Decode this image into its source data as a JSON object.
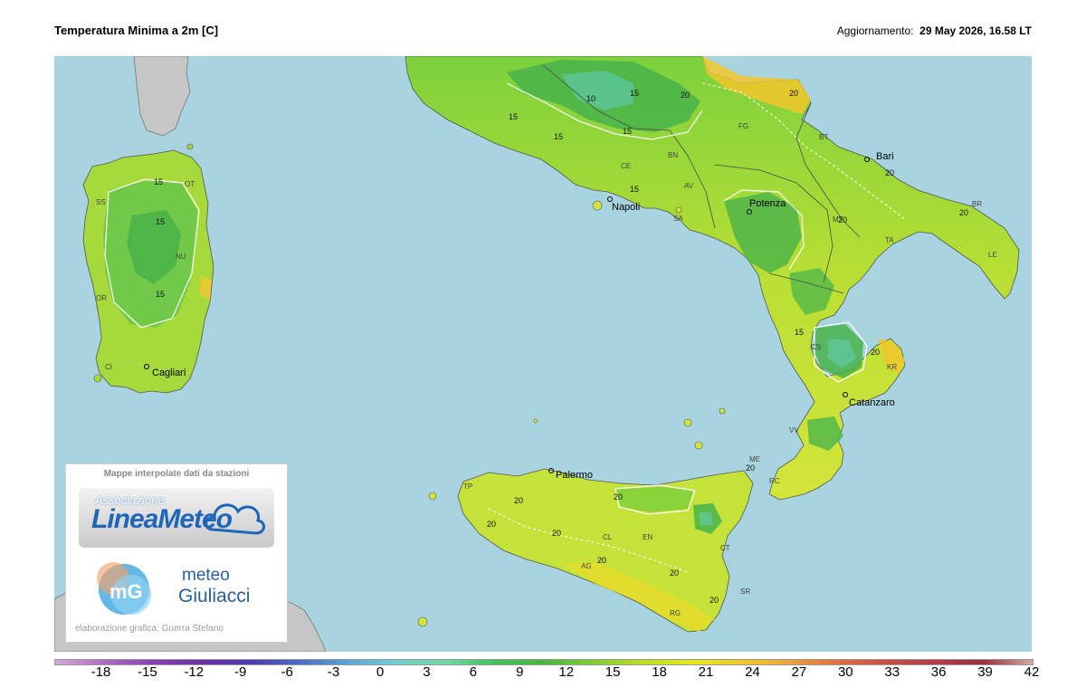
{
  "header": {
    "title": "Temperatura Minima a 2m [C]",
    "updated_label": "Aggiornamento:",
    "updated_value": "29 May 2026, 16.58 LT"
  },
  "cities": [
    "Bari",
    "Napoli",
    "Potenza",
    "Catanzaro",
    "Palermo",
    "Cagliari"
  ],
  "provinces": [
    "FG",
    "BT",
    "BR",
    "LE",
    "TA",
    "MT",
    "CE",
    "BN",
    "AV",
    "SA",
    "CS",
    "KR",
    "VV",
    "RC",
    "ME",
    "TP",
    "AG",
    "CL",
    "EN",
    "CT",
    "SR",
    "RG",
    "SS",
    "OT",
    "NU",
    "OR",
    "CI"
  ],
  "isolines": [
    "20",
    "15",
    "10",
    "20",
    "20",
    "15",
    "15",
    "15",
    "15",
    "20",
    "20",
    "20",
    "20",
    "20",
    "20",
    "20",
    "20",
    "20",
    "20",
    "15",
    "15",
    "15",
    "15",
    "20"
  ],
  "logos": {
    "caption": "Mappe interpolate dati da stazioni",
    "linea_meteo_assoc": "Associazione",
    "linea_meteo_name": "LineaMeteo",
    "mg_mark": "mG",
    "mg_brand_line1": "meteo",
    "mg_brand_line2": "Giuliacci",
    "credit": "elaborazione grafica: Guerra Stefano"
  },
  "legend": {
    "ticks": [
      "-18",
      "-15",
      "-12",
      "-9",
      "-6",
      "-3",
      "0",
      "3",
      "6",
      "9",
      "12",
      "15",
      "18",
      "21",
      "24",
      "27",
      "30",
      "33",
      "36",
      "39",
      "42"
    ],
    "range": [
      -21,
      42
    ],
    "colors": [
      "#d6a9d6",
      "#b06ac7",
      "#8a3fb5",
      "#6a2fa8",
      "#4f3bb0",
      "#4a6cc8",
      "#5aa6d8",
      "#6fd2d2",
      "#6ed8a4",
      "#3fc25a",
      "#44b83a",
      "#7fcf2d",
      "#b8e01e",
      "#e6e818",
      "#f4cc25",
      "#f0a238",
      "#e0703e",
      "#cc4c44",
      "#b43c48",
      "#9a2f3c",
      "#d8a8a8"
    ]
  },
  "colors": {
    "sea": "#a8d4e0",
    "foreign_land": "#c6c6c6",
    "land_warm": "#d2e53c",
    "land_mild": "#a6d93a",
    "land_cool": "#6cc64a",
    "land_cold": "#48b34a",
    "land_hot": "#f2c62c"
  }
}
